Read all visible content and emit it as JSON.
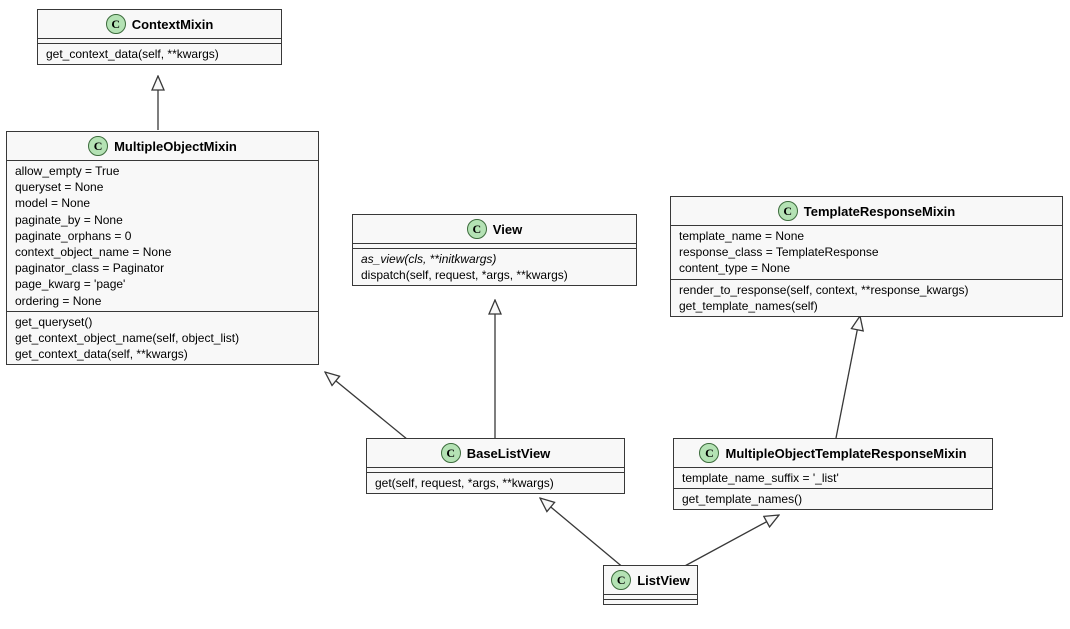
{
  "classes": {
    "contextMixin": {
      "name": "ContextMixin",
      "methods": [
        "get_context_data(self, **kwargs)"
      ]
    },
    "multipleObjectMixin": {
      "name": "MultipleObjectMixin",
      "attrs": [
        "allow_empty = True",
        "queryset = None",
        "model = None",
        "paginate_by = None",
        "paginate_orphans = 0",
        "context_object_name = None",
        "paginator_class = Paginator",
        "page_kwarg = 'page'",
        "ordering = None"
      ],
      "methods": [
        "get_queryset()",
        "get_context_object_name(self, object_list)",
        "get_context_data(self, **kwargs)"
      ]
    },
    "view": {
      "name": "View",
      "methods": [
        {
          "text": "as_view(cls, **initkwargs)",
          "italic": true
        },
        {
          "text": "dispatch(self, request, *args, **kwargs)",
          "italic": false
        }
      ]
    },
    "templateResponseMixin": {
      "name": "TemplateResponseMixin",
      "attrs": [
        "template_name = None",
        "response_class = TemplateResponse",
        "content_type = None"
      ],
      "methods": [
        "render_to_response(self, context, **response_kwargs)",
        "get_template_names(self)"
      ]
    },
    "baseListView": {
      "name": "BaseListView",
      "methods": [
        "get(self, request, *args, **kwargs)"
      ]
    },
    "multipleObjectTemplateResponseMixin": {
      "name": "MultipleObjectTemplateResponseMixin",
      "attrs": [
        "template_name_suffix = '_list'"
      ],
      "methods": [
        "get_template_names()"
      ]
    },
    "listView": {
      "name": "ListView"
    }
  }
}
